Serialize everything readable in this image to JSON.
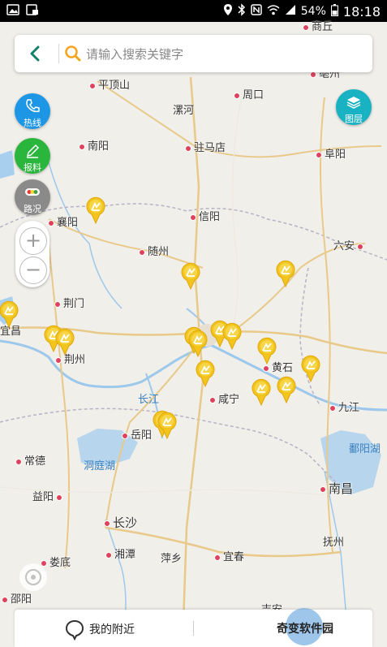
{
  "status_bar": {
    "battery": "54%",
    "time": "18:18"
  },
  "search": {
    "placeholder": "请输入搜索关键字"
  },
  "buttons": {
    "hotline": "热线",
    "report": "报料",
    "traffic": "路况",
    "layers": "图层"
  },
  "bottom": {
    "nearby": "我的附近",
    "watermark": "奇变软件园"
  },
  "cities": [
    "商丘",
    "亳州",
    "平顶山",
    "周口",
    "漯河",
    "南阳",
    "驻马店",
    "阜阳",
    "信阳",
    "襄阳",
    "随州",
    "六安",
    "荆门",
    "宜昌",
    "荆州",
    "黄石",
    "长江",
    "咸宁",
    "九江",
    "岳阳",
    "鄱阳湖",
    "常德",
    "洞庭湖",
    "南昌",
    "益阳",
    "长沙",
    "抚州",
    "湘潭",
    "萍乡",
    "宜春",
    "娄底",
    "邵阳",
    "吉安"
  ],
  "colors": {
    "accent": "#14a5a5",
    "hotline": "#1e96e6",
    "report": "#2ab53d",
    "traffic": "#8a8a8a",
    "layers": "#19b2c2",
    "marker": "#f2c41c"
  }
}
